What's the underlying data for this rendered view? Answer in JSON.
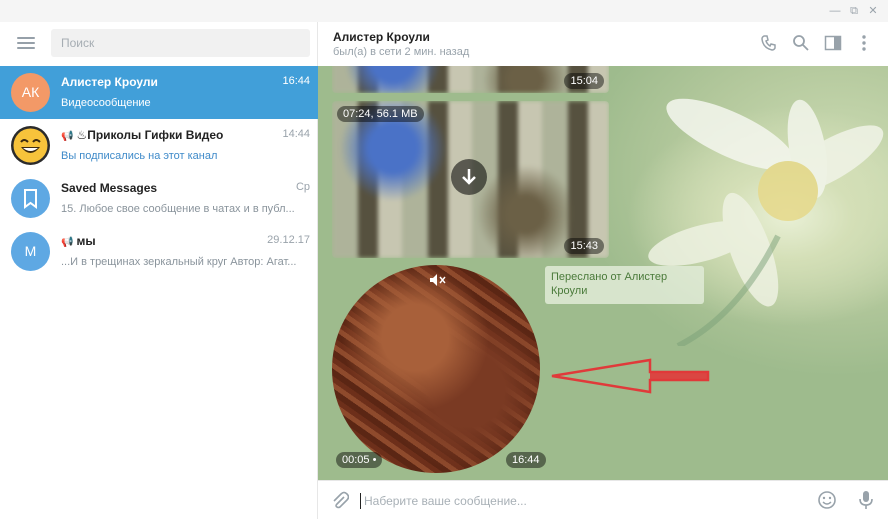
{
  "window": {
    "controls": [
      "minimize-icon",
      "restore-icon",
      "close-icon"
    ]
  },
  "sidebar": {
    "search_placeholder": "Поиск",
    "chats": [
      {
        "initials": "АК",
        "name": "Алистер Кроули",
        "time": "16:44",
        "preview": "Видеосообщение",
        "active": true,
        "avatar_color": "#f39967"
      },
      {
        "name": "♨Приколы Гифки Видео",
        "time": "14:44",
        "preview": "Вы подписались на этот канал",
        "channel": true
      },
      {
        "name": "Saved Messages",
        "time": "Ср",
        "preview": "15. Любое свое сообщение в чатах и в публ..."
      },
      {
        "initials": "М",
        "name": "мы",
        "time": "29.12.17",
        "preview": "...И в трещинах зеркальный круг Автор: Агат...",
        "channel": true,
        "avatar_color": "#5ea8e3"
      }
    ]
  },
  "header": {
    "name": "Алистер Кроули",
    "status": "был(а) в сети 2 мин. назад",
    "icons": [
      "phone-icon",
      "search-icon",
      "sidebar-toggle-icon",
      "more-icon"
    ]
  },
  "messages": {
    "video1_time": "15:04",
    "video2_meta": "07:24, 56.1 MB",
    "video2_time": "15:43",
    "forwarded_label": "Переслано от Алистер Кроули",
    "round_duration": "00:05",
    "round_time": "16:44"
  },
  "composer": {
    "placeholder": "Наберите ваше сообщение..."
  },
  "colors": {
    "accent": "#419fd9",
    "annotation_arrow": "#e03a3a"
  }
}
